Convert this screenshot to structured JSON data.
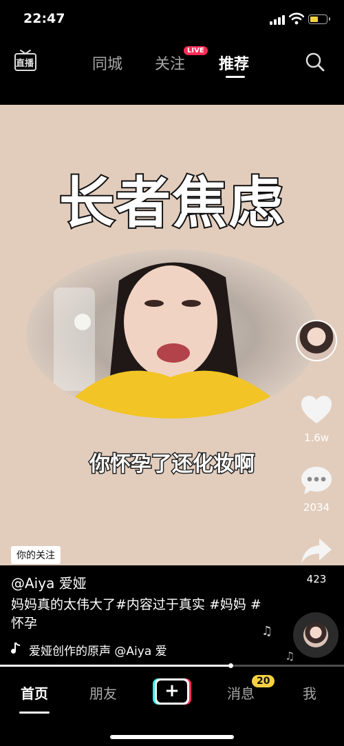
{
  "status_bar": {
    "time": "22:47",
    "battery_color": "#f5d142"
  },
  "top_nav": {
    "live_icon_label": "直播",
    "tabs": [
      {
        "label": "同城",
        "active": false
      },
      {
        "label": "关注",
        "active": false
      },
      {
        "label": "推荐",
        "active": true
      }
    ],
    "live_badge": "LIVE",
    "icons": [
      "live-tv-icon",
      "search-icon"
    ]
  },
  "video": {
    "title_overlay": "长者焦虑",
    "subtitle": "你怀孕了还化妆啊",
    "follow_tag": "你的关注"
  },
  "actions": {
    "like_count": "1.6w",
    "comment_count": "2034",
    "share_count": "423",
    "icons": [
      "heart-icon",
      "comment-icon",
      "share-icon"
    ]
  },
  "post": {
    "author": "@Aiya 爱娅",
    "caption": "妈妈真的太伟大了#内容过于真实 #妈妈 #怀孕",
    "music": "爱娅创作的原声    @Aiya 爱"
  },
  "progress": {
    "played_fraction": 0.67
  },
  "bottom_nav": {
    "tabs": [
      {
        "label": "首页",
        "active": true
      },
      {
        "label": "朋友",
        "active": false
      },
      {
        "label": "消息",
        "active": false
      },
      {
        "label": "我",
        "active": false
      }
    ],
    "create_label": "+",
    "messages_badge": "20",
    "accent_colors": {
      "cyan": "#25f4ee",
      "red": "#fe2c55",
      "badge": "#f5d142"
    }
  }
}
